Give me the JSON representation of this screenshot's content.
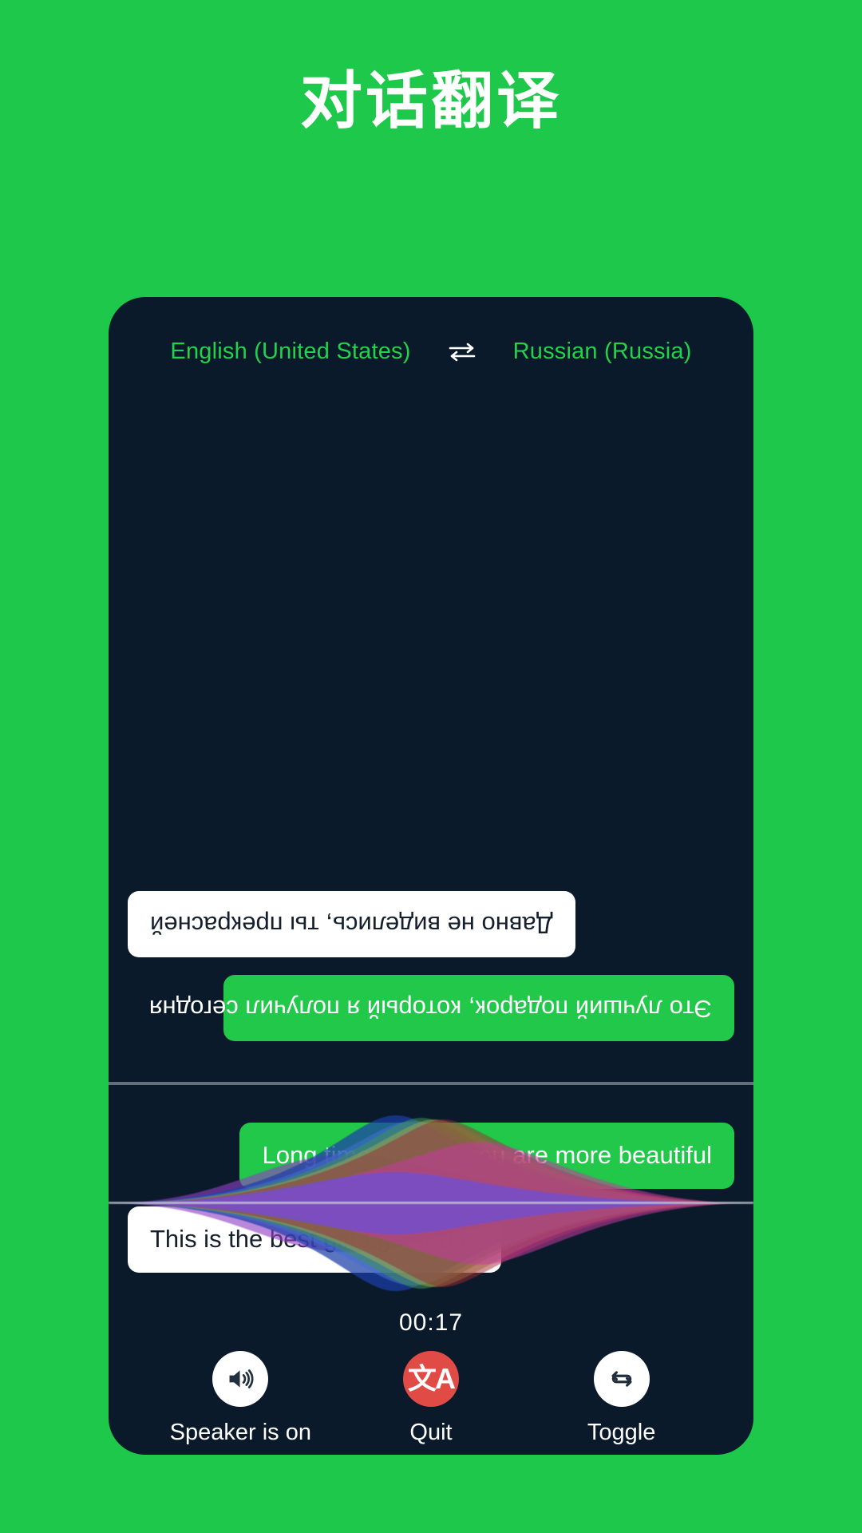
{
  "page": {
    "title": "对话翻译",
    "background_color": "#1dc84a",
    "panel_color": "#0a1a2a"
  },
  "language_bar": {
    "source_language": "English (United States)",
    "swap_icon": "swap-arrows-icon",
    "target_language": "Russian (Russia)",
    "text_color": "#22d24a"
  },
  "conversation": {
    "remote_panel": {
      "rotated": "180",
      "messages": [
        {
          "text": "Это лучший подарок, который я получил сегодня",
          "style": "green",
          "align": "left",
          "speaker": "remote"
        },
        {
          "text": "Давно не виделись, ты прекрасней",
          "style": "white",
          "align": "right",
          "speaker": "local"
        }
      ]
    },
    "local_panel": {
      "messages": [
        {
          "text": "Long time no see, you are more beautiful",
          "style": "green",
          "align": "right",
          "speaker": "local"
        },
        {
          "text": "This is the best gift I got today",
          "style": "white",
          "align": "left",
          "speaker": "remote"
        }
      ]
    }
  },
  "waveform": {
    "name": "audio-waveform-visualizer",
    "lobe_colors": [
      "#1f3fa8",
      "#3f6fcf",
      "#3c8f55",
      "#a8a84a",
      "#a02830",
      "#c43ba0",
      "#8f3fc4",
      "#6a4fd8"
    ]
  },
  "timer": {
    "value": "00:17"
  },
  "controls": [
    {
      "icon": "speaker-on-icon",
      "label": "Speaker is on",
      "circle_color": "#ffffff"
    },
    {
      "icon": "translate-icon",
      "label": "Quit",
      "circle_color": "#e04b46"
    },
    {
      "icon": "repeat-toggle-icon",
      "label": "Toggle",
      "circle_color": "#ffffff"
    }
  ]
}
